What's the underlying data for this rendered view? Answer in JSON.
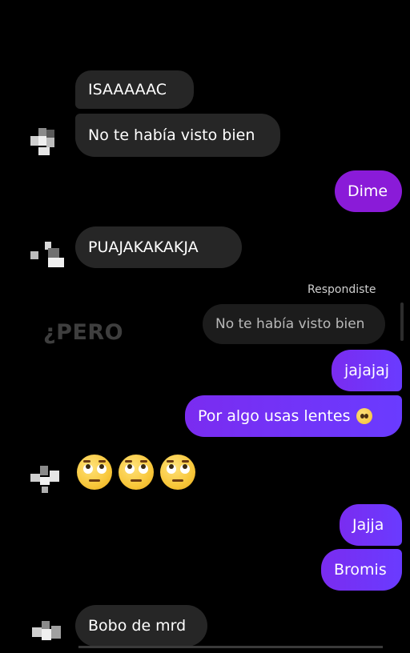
{
  "messages": {
    "m1": "ISAAAAAC",
    "m2": "No te había visto bien",
    "m3": "Dime",
    "m4": "PUAJAKAKAKJA",
    "reply_label": "Respondiste",
    "reply_quote": "No te había visto bien",
    "m5": "jajajaj",
    "m6": "Por algo usas lentes",
    "m7_emoji": "🙄🙄🙄",
    "m8": "Jajja",
    "m9": "Bromis",
    "m10": "Bobo de mrd"
  },
  "overlay": {
    "pero": "¿PERO"
  },
  "icons": {
    "avatar": "pixelated-avatar-icon",
    "eye_roll": "face-with-rolling-eyes-emoji",
    "pleading": "pleading-face-emoji"
  },
  "colors": {
    "background": "#000000",
    "incoming_bubble": "#262626",
    "outgoing_bubble": "#6a3bff",
    "dime_bubble": "#8a1bd8"
  }
}
